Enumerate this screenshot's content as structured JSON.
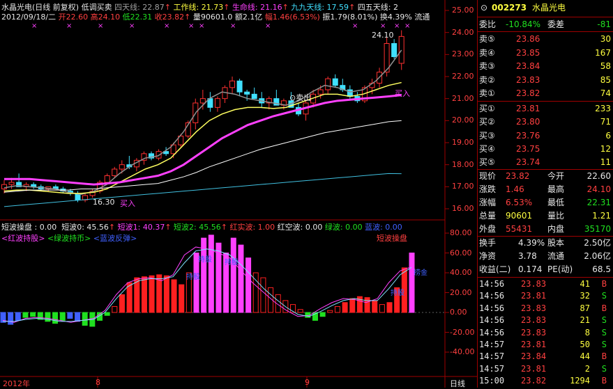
{
  "header": {
    "line1": {
      "title": "水晶光电(日线 前复权)",
      "indicator": "低调买卖",
      "ma4": "四天线: 22.87",
      "ma_work": "工作线: 21.73",
      "ma_life": "生命线: 21.16",
      "ma99": "九九天线: 17.59",
      "ma45": "四五天线: 2"
    },
    "line2": {
      "date": "2012/09/18/二",
      "open": "开22.60",
      "high": "高24.10",
      "low": "低22.31",
      "close": "收23.82",
      "vol": "量90601.0",
      "amt": "额2.1亿",
      "change": "幅1.46(6.53%)",
      "amp": "振1.79(8.01%)",
      "turn": "换4.39%",
      "float": "流通"
    }
  },
  "price_axis": [
    "25.00",
    "24.00",
    "23.00",
    "22.00",
    "21.00",
    "20.00",
    "19.00",
    "18.00",
    "17.00",
    "16.00"
  ],
  "annotations": {
    "high_label": "24.10",
    "sell_label": "卖出",
    "buy_label_1": "16.30",
    "buy_text_1": "买入",
    "buy_text_2": "买入"
  },
  "sub_header": {
    "a": "短波操盘 : 0.00",
    "b": "短波0: 45.56",
    "c": "短波1: 40.37",
    "d": "短波2: 45.56",
    "e": "红实波: 1.00",
    "f": "红空波: 0.00",
    "g": "绿波: 0.00",
    "h": "蓝波: 0.00"
  },
  "sub_legend": {
    "red": "<红波持股>",
    "green": "<绿波持币>",
    "blue": "<蓝波反弹>",
    "right": "短波操盘"
  },
  "sub_marks": {
    "m1": "持股",
    "m2": "持股",
    "m3": "持股",
    "m4": "捞金",
    "m5": "持股"
  },
  "sub_axis": [
    "80.00",
    "60.00",
    "40.00",
    "20.00",
    "0.00",
    "-20.00",
    "-40.00"
  ],
  "time_axis": {
    "year": "2012年",
    "m8": "8",
    "m9": "9",
    "period": "日线"
  },
  "stock": {
    "code": "002273",
    "name": "水晶光电"
  },
  "order_ratio": {
    "ratio_label": "委比",
    "ratio_value": "-10.84%",
    "diff_label": "委差",
    "diff_value": "-81"
  },
  "asks": [
    {
      "label": "卖⑤",
      "price": "23.86",
      "vol": "30"
    },
    {
      "label": "卖④",
      "price": "23.85",
      "vol": "167"
    },
    {
      "label": "卖③",
      "price": "23.84",
      "vol": "58"
    },
    {
      "label": "卖②",
      "price": "23.83",
      "vol": "85"
    },
    {
      "label": "卖①",
      "price": "23.82",
      "vol": "74"
    }
  ],
  "bids": [
    {
      "label": "买①",
      "price": "23.81",
      "vol": "233"
    },
    {
      "label": "买②",
      "price": "23.80",
      "vol": "71"
    },
    {
      "label": "买③",
      "price": "23.76",
      "vo": "",
      "vol": "6"
    },
    {
      "label": "买④",
      "price": "23.75",
      "vol": "12"
    },
    {
      "label": "买⑤",
      "price": "23.74",
      "vol": "11"
    }
  ],
  "quote": [
    {
      "l1": "现价",
      "v1": "23.82",
      "l2": "今开",
      "v2": "22.60"
    },
    {
      "l1": "涨跌",
      "v1": "1.46",
      "l2": "最高",
      "v2": "24.10"
    },
    {
      "l1": "涨幅",
      "v1": "6.53%",
      "l2": "最低",
      "v2": "22.31"
    },
    {
      "l1": "总量",
      "v1": "90601",
      "l2": "量比",
      "v2": "1.21"
    },
    {
      "l1": "外盘",
      "v1": "55431",
      "l2": "内盘",
      "v2": "35170"
    }
  ],
  "stats": [
    {
      "l1": "换手",
      "v1": "4.39%",
      "l2": "股本",
      "v2": "2.50亿"
    },
    {
      "l1": "净资",
      "v1": "3.78",
      "l2": "流通",
      "v2": "2.06亿"
    },
    {
      "l1": "收益(二)",
      "v1": "0.174",
      "l2": "PE(动)",
      "v2": "68.5"
    }
  ],
  "ticks": [
    {
      "t": "14:56",
      "p": "23.83",
      "v": "41",
      "s": "B"
    },
    {
      "t": "14:56",
      "p": "23.81",
      "v": "32",
      "s": "S"
    },
    {
      "t": "14:56",
      "p": "23.83",
      "v": "87",
      "s": "B"
    },
    {
      "t": "14:56",
      "p": "23.83",
      "v": "21",
      "s": "S"
    },
    {
      "t": "14:56",
      "p": "23.83",
      "v": "8",
      "s": "S"
    },
    {
      "t": "14:57",
      "p": "23.81",
      "v": "50",
      "s": "S"
    },
    {
      "t": "14:57",
      "p": "23.84",
      "v": "44",
      "s": "B"
    },
    {
      "t": "14:57",
      "p": "23.81",
      "v": "2",
      "s": "S"
    },
    {
      "t": "15:00",
      "p": "23.82",
      "v": "1294",
      "s": "B"
    }
  ]
}
